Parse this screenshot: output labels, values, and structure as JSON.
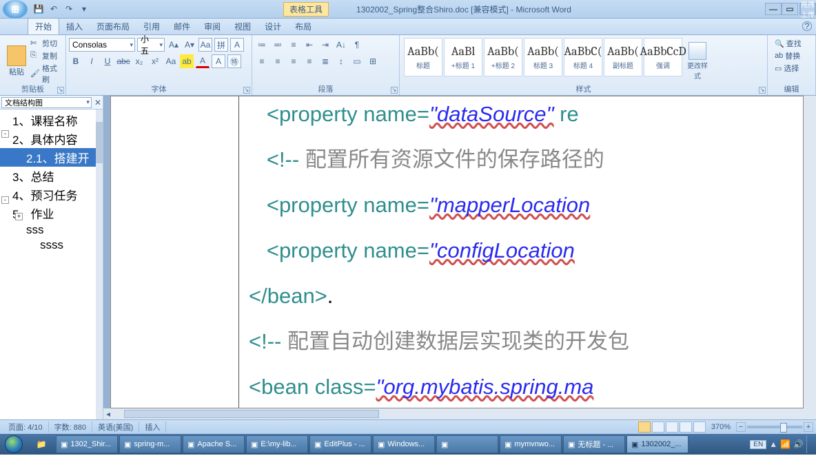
{
  "titlebar": {
    "contextual_label": "表格工具",
    "doc_title": "1302002_Spring整合Shiro.doc [兼容模式] - Microsoft Word",
    "pin_label": "拖拽上传"
  },
  "tabs": [
    "开始",
    "插入",
    "页面布局",
    "引用",
    "邮件",
    "审阅",
    "视图",
    "设计",
    "布局"
  ],
  "tabs_active_index": 0,
  "ribbon": {
    "clipboard": {
      "paste": "粘贴",
      "cut": "剪切",
      "copy": "复制",
      "format_painter": "格式刷",
      "group": "剪贴板"
    },
    "font": {
      "name": "Consolas",
      "size": "小五",
      "group": "字体"
    },
    "paragraph": {
      "group": "段落"
    },
    "styles": {
      "items": [
        {
          "prev": "AaBb(",
          "name": "标题"
        },
        {
          "prev": "AaBl",
          "name": "+标题 1"
        },
        {
          "prev": "AaBb(",
          "name": "+标题 2"
        },
        {
          "prev": "AaBb(",
          "name": "标题 3"
        },
        {
          "prev": "AaBbC(",
          "name": "标题 4"
        },
        {
          "prev": "AaBb(",
          "name": "副标题"
        },
        {
          "prev": "AaBbCcD",
          "name": "强调"
        }
      ],
      "change": "更改样式",
      "group": "样式"
    },
    "editing": {
      "find": "查找",
      "replace": "替换",
      "select": "选择",
      "group": "编辑"
    }
  },
  "docmap": {
    "dropdown": "文档结构图",
    "items": [
      {
        "text": "1、课程名称",
        "indent": 0
      },
      {
        "text": "2、具体内容",
        "indent": 0,
        "exp": "-"
      },
      {
        "text": "2.1、搭建开",
        "indent": 1,
        "selected": true
      },
      {
        "text": "3、总结",
        "indent": 0
      },
      {
        "text": "4、预习任务",
        "indent": 0
      },
      {
        "text": "5、作业",
        "indent": 0,
        "exp": "-"
      },
      {
        "text": "sss",
        "indent": 1,
        "exp": "+"
      },
      {
        "text": "ssss",
        "indent": 2
      }
    ]
  },
  "document": {
    "lines": [
      {
        "segs": [
          {
            "t": "   <property",
            "c": "tag"
          },
          {
            "t": " ",
            "c": ""
          },
          {
            "t": "name=",
            "c": "attr"
          },
          {
            "t": "\"dataSource\"",
            "c": "str str-u"
          },
          {
            "t": " re",
            "c": "attr"
          }
        ]
      },
      {
        "segs": []
      },
      {
        "segs": [
          {
            "t": "   <!-- ",
            "c": "tag"
          },
          {
            "t": "配置所有资源文件的保存路径的",
            "c": "cmt"
          }
        ]
      },
      {
        "segs": []
      },
      {
        "segs": [
          {
            "t": "   <property",
            "c": "tag"
          },
          {
            "t": " ",
            "c": ""
          },
          {
            "t": "name=",
            "c": "attr"
          },
          {
            "t": "\"mapperLocation",
            "c": "str str-u"
          }
        ]
      },
      {
        "segs": []
      },
      {
        "segs": [
          {
            "t": "   <property",
            "c": "tag"
          },
          {
            "t": " ",
            "c": ""
          },
          {
            "t": "name=",
            "c": "attr"
          },
          {
            "t": "\"configLocation",
            "c": "str str-u"
          }
        ]
      },
      {
        "segs": []
      },
      {
        "segs": [
          {
            "t": "</bean>",
            "c": "tag"
          },
          {
            "t": ".",
            "c": ""
          }
        ]
      },
      {
        "segs": []
      },
      {
        "segs": [
          {
            "t": "<!-- ",
            "c": "tag"
          },
          {
            "t": "配置自动创建数据层实现类的开发包",
            "c": "cmt"
          }
        ]
      },
      {
        "segs": []
      },
      {
        "segs": [
          {
            "t": "<bean",
            "c": "tag"
          },
          {
            "t": " ",
            "c": ""
          },
          {
            "t": "class=",
            "c": "attr"
          },
          {
            "t": "\"org.mybatis.spring.ma",
            "c": "str str-u"
          }
        ]
      }
    ]
  },
  "statusbar": {
    "page": "页面: 4/10",
    "words": "字数: 880",
    "lang": "英语(美国)",
    "mode": "插入",
    "zoom": "370%"
  },
  "taskbar": {
    "items": [
      {
        "label": "1302_Shir..."
      },
      {
        "label": "spring-m..."
      },
      {
        "label": "Apache S..."
      },
      {
        "label": "E:\\my-lib..."
      },
      {
        "label": "EditPlus - ..."
      },
      {
        "label": "Windows..."
      },
      {
        "label": ""
      },
      {
        "label": "mymvnwo..."
      },
      {
        "label": "无标题 - ..."
      },
      {
        "label": "1302002_...",
        "active": true
      }
    ],
    "lang": "EN"
  }
}
